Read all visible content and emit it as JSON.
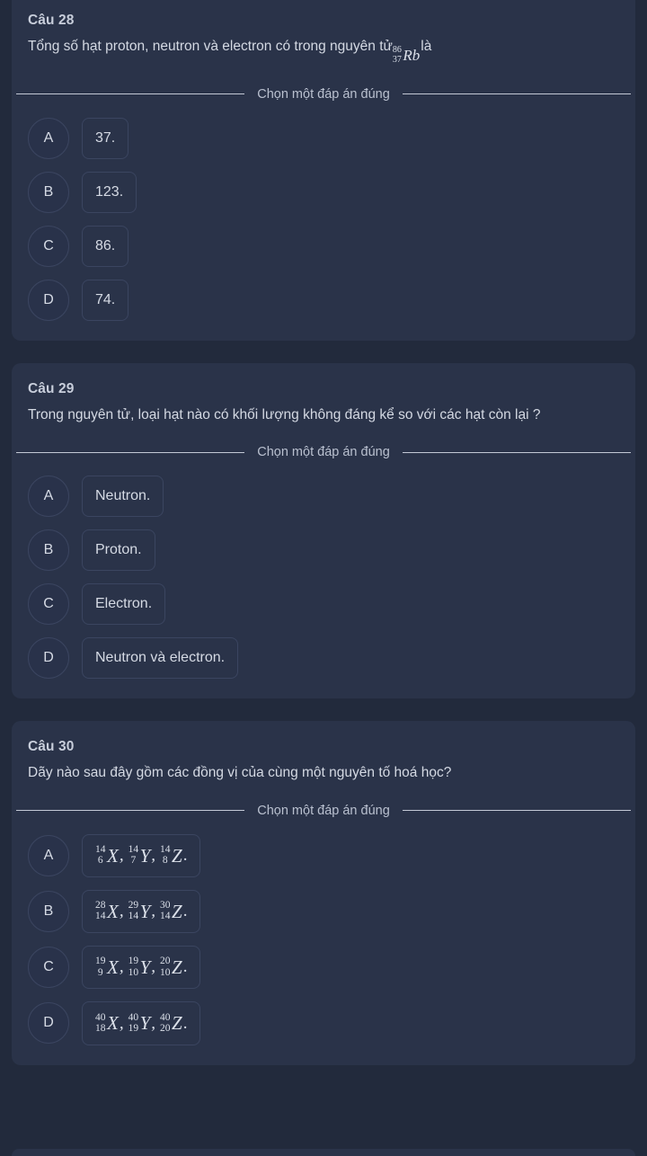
{
  "theme": {
    "page_bg": "#222a3c",
    "card_bg": "#2a3349",
    "border": "#3b4560",
    "text": "#d5dae4",
    "muted": "#b9c0cf"
  },
  "choose_label": "Chọn một đáp án đúng",
  "questions": [
    {
      "number": "Câu 28",
      "text_before": "Tổng số hạt proton, neutron và electron có trong nguyên tử",
      "text_after": "là",
      "inline_isotope": {
        "mass": "86",
        "atomic": "37",
        "symbol": "Rb"
      },
      "options": [
        {
          "key": "A",
          "text": "37."
        },
        {
          "key": "B",
          "text": "123."
        },
        {
          "key": "C",
          "text": "86."
        },
        {
          "key": "D",
          "text": "74."
        }
      ]
    },
    {
      "number": "Câu 29",
      "text_before": "Trong nguyên tử, loại hạt nào có khối lượng không đáng kể so với các hạt còn lại ?",
      "text_after": "",
      "options": [
        {
          "key": "A",
          "text": "Neutron."
        },
        {
          "key": "B",
          "text": "Proton."
        },
        {
          "key": "C",
          "text": "Electron."
        },
        {
          "key": "D",
          "text": "Neutron và electron."
        }
      ]
    },
    {
      "number": "Câu 30",
      "text_before": "Dãy nào sau đây gồm các đồng vị của cùng một nguyên tố hoá học?",
      "text_after": "",
      "options": [
        {
          "key": "A",
          "isotopes": [
            {
              "mass": "14",
              "atomic": "6",
              "symbol": "X"
            },
            {
              "mass": "14",
              "atomic": "7",
              "symbol": "Y"
            },
            {
              "mass": "14",
              "atomic": "8",
              "symbol": "Z"
            }
          ]
        },
        {
          "key": "B",
          "isotopes": [
            {
              "mass": "28",
              "atomic": "14",
              "symbol": "X"
            },
            {
              "mass": "29",
              "atomic": "14",
              "symbol": "Y"
            },
            {
              "mass": "30",
              "atomic": "14",
              "symbol": "Z"
            }
          ]
        },
        {
          "key": "C",
          "isotopes": [
            {
              "mass": "19",
              "atomic": "9",
              "symbol": "X"
            },
            {
              "mass": "19",
              "atomic": "10",
              "symbol": "Y"
            },
            {
              "mass": "20",
              "atomic": "10",
              "symbol": "Z"
            }
          ]
        },
        {
          "key": "D",
          "isotopes": [
            {
              "mass": "40",
              "atomic": "18",
              "symbol": "X"
            },
            {
              "mass": "40",
              "atomic": "19",
              "symbol": "Y"
            },
            {
              "mass": "40",
              "atomic": "20",
              "symbol": "Z"
            }
          ]
        }
      ]
    }
  ]
}
